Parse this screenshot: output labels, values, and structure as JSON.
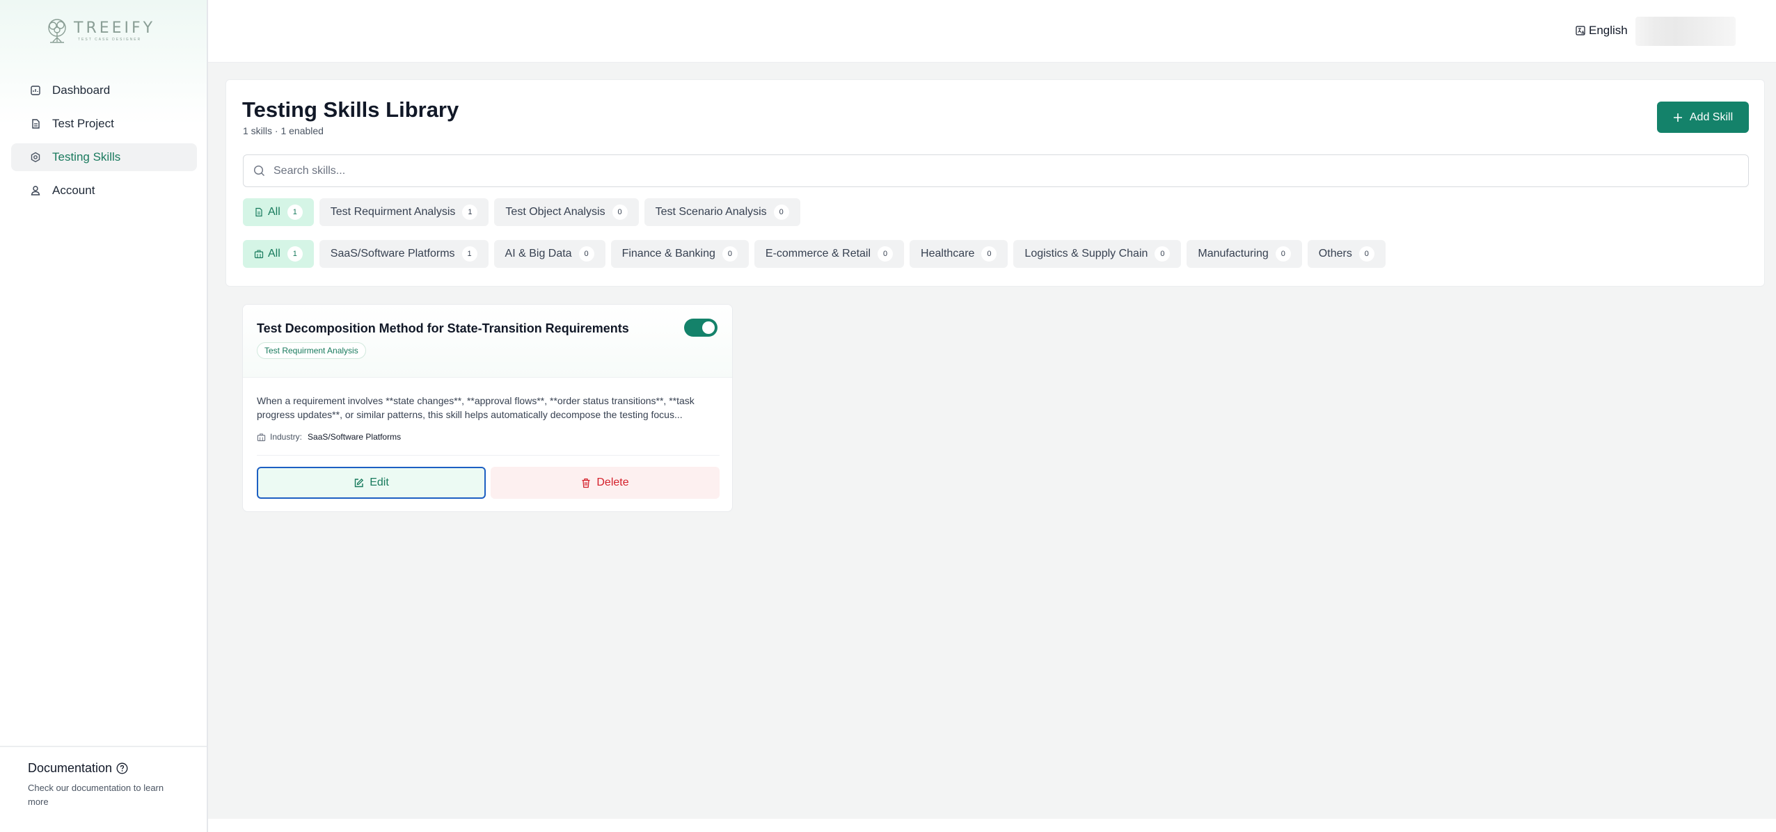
{
  "brand": {
    "name": "TREEIFY",
    "tagline": "TEST CASE DESIGNER",
    "accent": "#14826a"
  },
  "sidebar": {
    "items": [
      {
        "label": "Dashboard",
        "icon": "dashboard-icon",
        "active": false
      },
      {
        "label": "Test Project",
        "icon": "document-icon",
        "active": false
      },
      {
        "label": "Testing Skills",
        "icon": "skills-icon",
        "active": true
      },
      {
        "label": "Account",
        "icon": "user-icon",
        "active": false
      }
    ],
    "documentation": {
      "title": "Documentation",
      "description": "Check our documentation to learn more"
    }
  },
  "topbar": {
    "language": "English"
  },
  "header": {
    "title": "Testing Skills Library",
    "subtitle": "1 skills · 1 enabled",
    "add_label": "Add Skill"
  },
  "search": {
    "placeholder": "Search skills...",
    "value": ""
  },
  "category_filters": [
    {
      "label": "All",
      "count": "1",
      "active": true
    },
    {
      "label": "Test Requirment Analysis",
      "count": "1",
      "active": false
    },
    {
      "label": "Test Object Analysis",
      "count": "0",
      "active": false
    },
    {
      "label": "Test Scenario Analysis",
      "count": "0",
      "active": false
    }
  ],
  "industry_filters": [
    {
      "label": "All",
      "count": "1",
      "active": true
    },
    {
      "label": "SaaS/Software Platforms",
      "count": "1",
      "active": false
    },
    {
      "label": "AI & Big Data",
      "count": "0",
      "active": false
    },
    {
      "label": "Finance & Banking",
      "count": "0",
      "active": false
    },
    {
      "label": "E-commerce & Retail",
      "count": "0",
      "active": false
    },
    {
      "label": "Healthcare",
      "count": "0",
      "active": false
    },
    {
      "label": "Logistics & Supply Chain",
      "count": "0",
      "active": false
    },
    {
      "label": "Manufacturing",
      "count": "0",
      "active": false
    },
    {
      "label": "Others",
      "count": "0",
      "active": false
    }
  ],
  "skills": [
    {
      "title": "Test Decomposition Method for State-Transition Requirements",
      "tag": "Test Requirment Analysis",
      "enabled": true,
      "description_line1": "When a requirement involves **state changes**, **approval flows**, **order status transitions**, **task",
      "description_line2": "progress updates**, or similar patterns, this skill helps automatically decompose the testing focus...",
      "industry_label": "Industry:",
      "industry_value": "SaaS/Software Platforms",
      "edit_label": "Edit",
      "delete_label": "Delete"
    }
  ]
}
